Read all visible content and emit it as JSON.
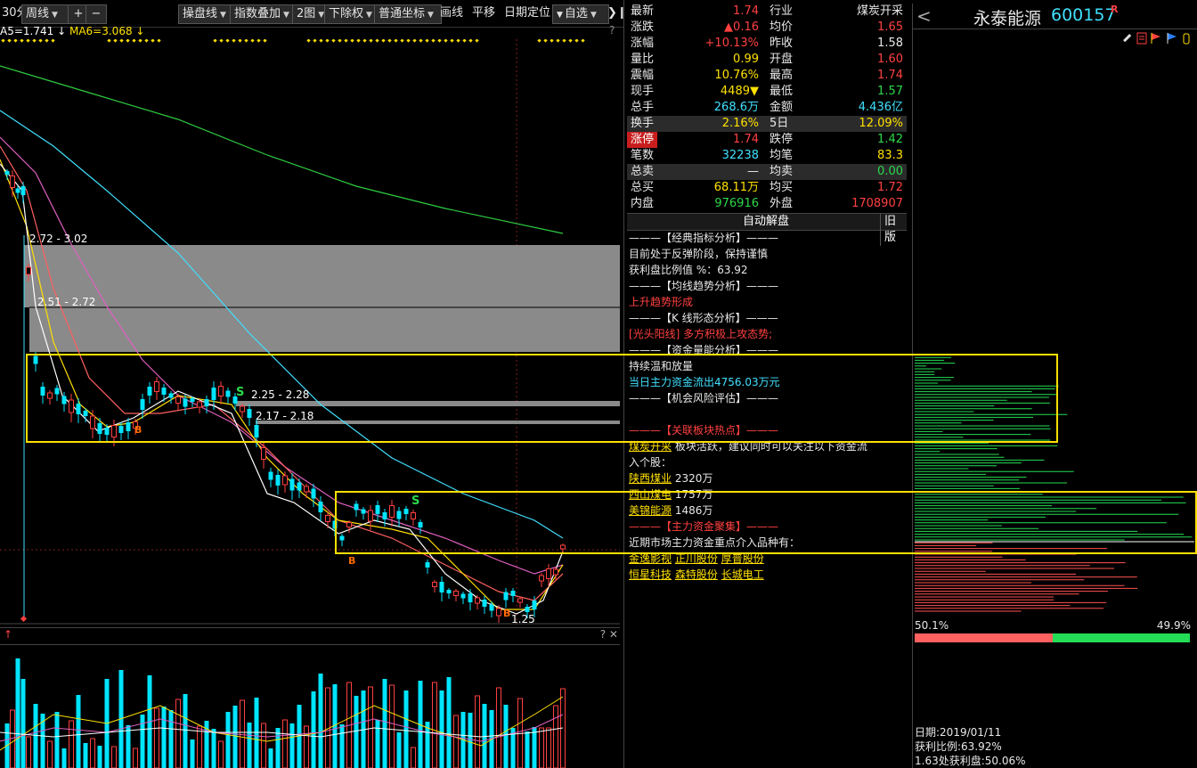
{
  "toolbar": {
    "period_label": "30分",
    "cycle": "周线",
    "plus": "+",
    "minus": "−",
    "operate_line": "操盘线",
    "index_overlay": "指数叠加",
    "two_chart": "2图",
    "adjust": "下除权",
    "coord": "普通坐标",
    "draw": "画线",
    "pan": "平移",
    "date_locate": "日期定位",
    "watchlist": "自选",
    "collapse": "❯❙"
  },
  "ma": {
    "ma5": "A5=1.741",
    "ma5_arrow": "↓",
    "ma6": "MA6=3.068",
    "ma6_arrow": "↓",
    "help": "?"
  },
  "chart_labels": {
    "zone1": "2.72 - 3.02",
    "zone2": "2.51 - 2.72",
    "zone3": "2.25 - 2.28",
    "zone4": "2.17 - 2.18",
    "low_label": "1.25",
    "buy1": "B",
    "buy2": "B",
    "buy3": "B",
    "sell1": "S",
    "sell2": "S"
  },
  "subbar": {
    "left": "↑",
    "right": "? ✕"
  },
  "quote": {
    "rows": [
      {
        "l1": "最新",
        "v1": "1.74",
        "c1": "red",
        "l2": "行业",
        "v2": "煤炭开采",
        "c2": "wht"
      },
      {
        "l1": "涨跌",
        "v1": "▲0.16",
        "c1": "red",
        "l2": "均价",
        "v2": "1.65",
        "c2": "red"
      },
      {
        "l1": "涨幅",
        "v1": "+10.13%",
        "c1": "red",
        "l2": "昨收",
        "v2": "1.58",
        "c2": "wht"
      },
      {
        "l1": "量比",
        "v1": "0.99",
        "c1": "yel",
        "l2": "开盘",
        "v2": "1.60",
        "c2": "red"
      },
      {
        "l1": "震幅",
        "v1": "10.76%",
        "c1": "yel",
        "l2": "最高",
        "v2": "1.74",
        "c2": "red"
      },
      {
        "l1": "现手",
        "v1": "4489▼",
        "c1": "yel",
        "l2": "最低",
        "v2": "1.57",
        "c2": "green"
      },
      {
        "l1": "总手",
        "v1": "268.6万",
        "c1": "cyan",
        "l2": "金额",
        "v2": "4.436亿",
        "c2": "cyan"
      },
      {
        "l1": "换手",
        "v1": "2.16%",
        "c1": "yel",
        "l2": "5日",
        "v2": "12.09%",
        "c2": "yel"
      },
      {
        "l1": "涨停",
        "v1": "1.74",
        "c1": "red",
        "l2": "跌停",
        "v2": "1.42",
        "c2": "green"
      },
      {
        "l1": "笔数",
        "v1": "32238",
        "c1": "cyan",
        "l2": "均笔",
        "v2": "83.3",
        "c2": "yel"
      },
      {
        "l1": "总卖",
        "v1": "—",
        "c1": "wht",
        "l2": "均卖",
        "v2": "0.00",
        "c2": "green"
      },
      {
        "l1": "总买",
        "v1": "68.11万",
        "c1": "yel",
        "l2": "均买",
        "v2": "1.72",
        "c2": "red"
      },
      {
        "l1": "内盘",
        "v1": "976916",
        "c1": "green",
        "l2": "外盘",
        "v2": "1708907",
        "c2": "red"
      }
    ],
    "auto_analysis": "自动解盘",
    "old_version": "旧版"
  },
  "analysis": {
    "l1": "———【经典指标分析】———",
    "l2": "目前处于反弹阶段，保持谨慎",
    "l3": "获利盘比例值 %：63.92",
    "l4": "———【均线趋势分析】———",
    "l5": "上升趋势形成",
    "l6": "———【K 线形态分析】———",
    "l7": "[光头阳线] 多方积极上攻态势;",
    "l8": "———【资金量能分析】———",
    "l9": "持续温和放量",
    "l10": "当日主力资金流出4756.03万元",
    "l11": "———【机会风险评估】———",
    "l12": "———【关联板块热点】———",
    "l13a": "煤炭开采",
    "l13b": " 板块活跃，建议同时可以关注以下资金流",
    "l14": "入个股：",
    "s1n": "陕西煤业",
    "s1v": " 2320万",
    "s2n": "西山煤电",
    "s2v": " 1757万",
    "s3n": "美锦能源",
    "s3v": " 1486万",
    "l18": "———【主力资金聚集】———",
    "l19": "近期市场主力资金重点介入品种有：",
    "links1": [
      "金逸影视",
      "正川股份",
      "厚普股份"
    ],
    "links2": [
      "恒星科技",
      "森特股份",
      "长城电工"
    ]
  },
  "right": {
    "prev": "<",
    "name": "永泰能源",
    "code": "600157",
    "flag": "R",
    "pct_left": "50.1%",
    "pct_right": "49.9%",
    "date": "日期:2019/01/11",
    "profit": "获利比例:63.92%",
    "profit_at": "1.63处获利盘:50.06%"
  },
  "colors": {
    "up": "#ff4040",
    "down": "#00e5ff",
    "yellow": "#ffe000",
    "green": "#2bd94a"
  }
}
